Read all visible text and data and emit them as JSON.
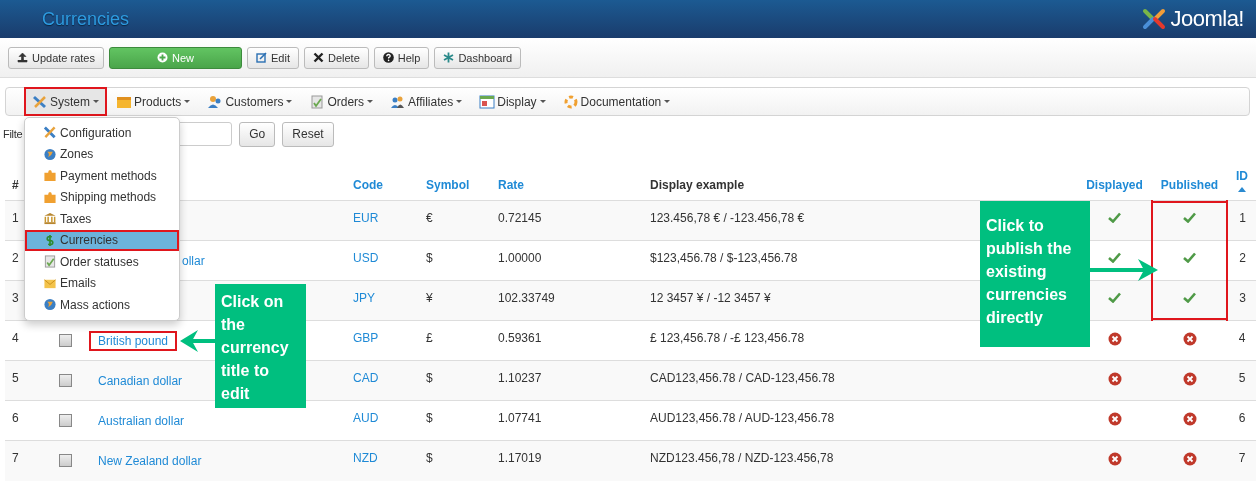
{
  "header": {
    "title": "Currencies",
    "logo_text": "Joomla!"
  },
  "toolbar": [
    {
      "label": "Update rates",
      "kind": "upload"
    },
    {
      "label": "New",
      "kind": "new"
    },
    {
      "label": "Edit",
      "kind": "edit"
    },
    {
      "label": "Delete",
      "kind": "delete"
    },
    {
      "label": "Help",
      "kind": "help"
    },
    {
      "label": "Dashboard",
      "kind": "dashboard"
    }
  ],
  "menu": [
    {
      "label": "System",
      "kind": "wrench",
      "highlighted": true
    },
    {
      "label": "Products",
      "kind": "box",
      "highlighted": false
    },
    {
      "label": "Customers",
      "kind": "person",
      "highlighted": false
    },
    {
      "label": "Orders",
      "kind": "document",
      "highlighted": false
    },
    {
      "label": "Affiliates",
      "kind": "people",
      "highlighted": false
    },
    {
      "label": "Display",
      "kind": "window",
      "highlighted": false
    },
    {
      "label": "Documentation",
      "kind": "ring",
      "highlighted": false
    }
  ],
  "dropdown": [
    {
      "label": "Configuration",
      "kind": "wrench",
      "selected": false
    },
    {
      "label": "Zones",
      "kind": "globe",
      "selected": false
    },
    {
      "label": "Payment methods",
      "kind": "puzzle",
      "selected": false
    },
    {
      "label": "Shipping methods",
      "kind": "puzzle",
      "selected": false
    },
    {
      "label": "Taxes",
      "kind": "bank",
      "selected": false
    },
    {
      "label": "Currencies",
      "kind": "dollar",
      "selected": true
    },
    {
      "label": "Order statuses",
      "kind": "document",
      "selected": false
    },
    {
      "label": "Emails",
      "kind": "envelope",
      "selected": false
    },
    {
      "label": "Mass actions",
      "kind": "globe",
      "selected": false
    }
  ],
  "filter": {
    "label": "Filte",
    "buttons": [
      "Go",
      "Reset"
    ]
  },
  "table": {
    "columns": [
      {
        "label": "#",
        "link": false
      },
      {
        "label": "Code",
        "link": true
      },
      {
        "label": "Symbol",
        "link": true
      },
      {
        "label": "Rate",
        "link": true
      },
      {
        "label": "Display example",
        "link": false
      },
      {
        "label": "Displayed",
        "link": true
      },
      {
        "label": "Published",
        "link": true
      },
      {
        "label": "ID",
        "link": true,
        "sorted": true
      }
    ],
    "rows": [
      {
        "num": "1",
        "code": "EUR",
        "symbol": "€",
        "rate": "0.72145",
        "example": "123.456,78 € / -123.456,78 €",
        "displayed": true,
        "published": true,
        "published_highlighted": true,
        "id": "1"
      },
      {
        "num": "2",
        "name": "ollar",
        "name_highlighted": false,
        "code": "USD",
        "symbol": "$",
        "rate": "1.00000",
        "example": "$123,456.78 / $-123,456.78",
        "displayed": true,
        "published": true,
        "published_highlighted": true,
        "id": "2"
      },
      {
        "num": "3",
        "code": "JPY",
        "symbol": "¥",
        "rate": "102.33749",
        "example": "12 3457 ¥ / -12 3457 ¥",
        "displayed": true,
        "published": true,
        "published_highlighted": true,
        "id": "3"
      },
      {
        "num": "4",
        "checked": false,
        "name": "British pound",
        "name_highlighted": true,
        "code": "GBP",
        "symbol": "£",
        "rate": "0.59361",
        "example": "£ 123,456.78 / -£ 123,456.78",
        "displayed": false,
        "published": false,
        "published_highlighted": false,
        "id": "4"
      },
      {
        "num": "5",
        "checked": false,
        "name": "Canadian dollar",
        "name_highlighted": false,
        "code": "CAD",
        "symbol": "$",
        "rate": "1.10237",
        "example": "CAD123,456.78 / CAD-123,456.78",
        "displayed": false,
        "published": false,
        "published_highlighted": false,
        "id": "5"
      },
      {
        "num": "6",
        "checked": false,
        "name": "Australian dollar",
        "name_highlighted": false,
        "code": "AUD",
        "symbol": "$",
        "rate": "1.07741",
        "example": "AUD123,456.78 / AUD-123,456.78",
        "displayed": false,
        "published": false,
        "published_highlighted": false,
        "id": "6"
      },
      {
        "num": "7",
        "checked": false,
        "name": "New Zealand dollar",
        "name_highlighted": false,
        "code": "NZD",
        "symbol": "$",
        "rate": "1.17019",
        "example": "NZD123.456,78 / NZD-123.456,78",
        "displayed": false,
        "published": false,
        "published_highlighted": false,
        "id": "7"
      }
    ]
  },
  "callouts": [
    {
      "text": "Click on the currency title to edit",
      "kind": "left"
    },
    {
      "text": "Click to publish the existing currencies directly",
      "kind": "right"
    }
  ]
}
